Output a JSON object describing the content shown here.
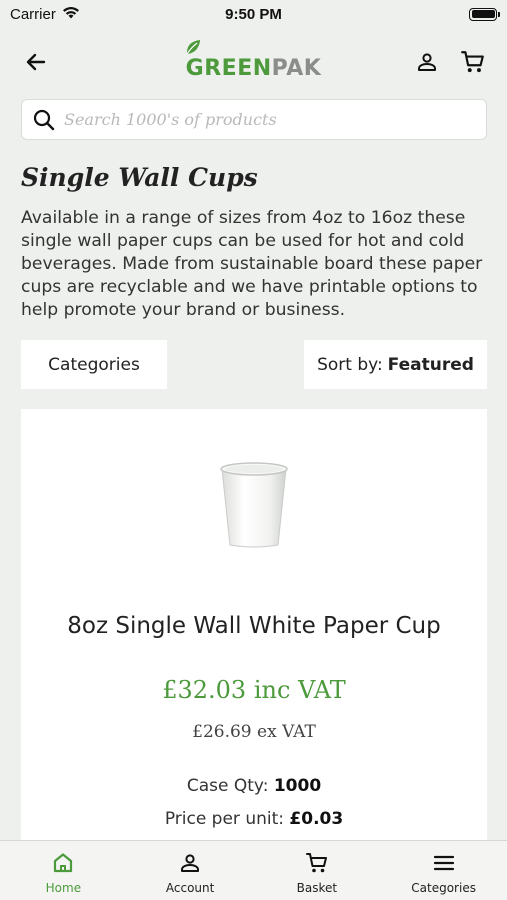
{
  "status": {
    "carrier": "Carrier",
    "time": "9:50 PM"
  },
  "brand": {
    "name_part1": "GREEN",
    "name_part2": "PAK",
    "primary_color": "#4c9a3c",
    "secondary_color": "#8a8d8a"
  },
  "search": {
    "placeholder": "Search 1000's of products"
  },
  "category": {
    "title": "Single Wall Cups",
    "description": "Available in a range of sizes from 4oz to 16oz these single wall paper cups can be used for hot and cold beverages. Made from sustainable board these paper cups are recyclable and we have printable options to help promote your brand or business."
  },
  "controls": {
    "categories_label": "Categories",
    "sort_prefix": "Sort by:",
    "sort_value": "Featured"
  },
  "product": {
    "name": "8oz Single Wall White Paper Cup",
    "price_inc": "£32.03 inc VAT",
    "price_ex": "£26.69 ex VAT",
    "case_qty_label": "Case Qty:",
    "case_qty_value": "1000",
    "unit_price_label": "Price per unit:",
    "unit_price_value": "£0.03"
  },
  "tabs": [
    {
      "label": "Home",
      "icon": "home-icon",
      "active": true
    },
    {
      "label": "Account",
      "icon": "user-icon",
      "active": false
    },
    {
      "label": "Basket",
      "icon": "cart-icon",
      "active": false
    },
    {
      "label": "Categories",
      "icon": "menu-icon",
      "active": false
    }
  ]
}
